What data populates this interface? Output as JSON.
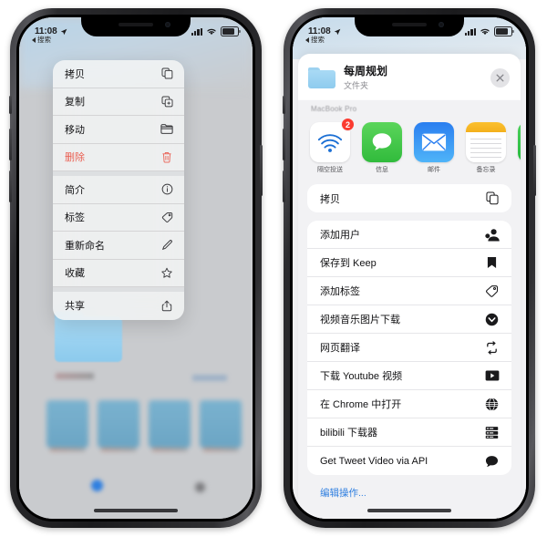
{
  "left_phone": {
    "status_bar": {
      "time": "11:08",
      "location_icon": "location-arrow-icon",
      "signal_icon": "cellular-signal-icon",
      "wifi_icon": "wifi-icon",
      "battery_icon": "battery-icon"
    },
    "back_link": "搜索",
    "context_menu": {
      "groups": [
        {
          "items": [
            {
              "label": "拷贝",
              "icon": "copy-icon",
              "destructive": false
            },
            {
              "label": "复制",
              "icon": "duplicate-icon",
              "destructive": false
            },
            {
              "label": "移动",
              "icon": "folder-move-icon",
              "destructive": false
            },
            {
              "label": "删除",
              "icon": "trash-icon",
              "destructive": true
            }
          ]
        },
        {
          "items": [
            {
              "label": "简介",
              "icon": "info-circle-icon",
              "destructive": false
            },
            {
              "label": "标签",
              "icon": "tag-icon",
              "destructive": false
            },
            {
              "label": "重新命名",
              "icon": "pencil-icon",
              "destructive": false
            },
            {
              "label": "收藏",
              "icon": "star-icon",
              "destructive": false
            }
          ]
        },
        {
          "items": [
            {
              "label": "共享",
              "icon": "share-icon",
              "destructive": false
            }
          ]
        }
      ]
    },
    "background": {
      "folder_icon": "folder-icon",
      "blurred_content": true
    }
  },
  "right_phone": {
    "status_bar": {
      "time": "11:08",
      "location_icon": "location-arrow-icon",
      "signal_icon": "cellular-signal-icon",
      "wifi_icon": "wifi-icon",
      "battery_icon": "battery-icon"
    },
    "back_link": "搜索",
    "share_sheet": {
      "header": {
        "icon": "folder-icon",
        "title": "每周规划",
        "subtitle": "文件夹",
        "close_icon": "close-icon"
      },
      "section_label": "MacBook Pro",
      "apps": [
        {
          "name": "隔空投送",
          "icon": "airdrop-icon",
          "badge": "2"
        },
        {
          "name": "信息",
          "icon": "messages-icon",
          "badge": ""
        },
        {
          "name": "邮件",
          "icon": "mail-icon",
          "badge": ""
        },
        {
          "name": "备忘录",
          "icon": "notes-icon",
          "badge": ""
        },
        {
          "name": "",
          "icon": "wechat-icon",
          "badge": ""
        }
      ],
      "action_groups": [
        {
          "items": [
            {
              "label": "拷贝",
              "icon": "copy-icon"
            }
          ]
        },
        {
          "items": [
            {
              "label": "添加用户",
              "icon": "add-user-icon"
            },
            {
              "label": "保存到 Keep",
              "icon": "bookmark-icon"
            },
            {
              "label": "添加标签",
              "icon": "tag-icon"
            },
            {
              "label": "视频音乐图片下载",
              "icon": "download-circle-icon"
            },
            {
              "label": "网页翻译",
              "icon": "refresh-icon"
            },
            {
              "label": "下载 Youtube 视频",
              "icon": "video-play-icon"
            },
            {
              "label": "在 Chrome 中打开",
              "icon": "globe-icon"
            },
            {
              "label": "bilibili 下载器",
              "icon": "server-list-icon"
            },
            {
              "label": "Get Tweet Video via API",
              "icon": "speech-bubble-icon"
            }
          ]
        }
      ],
      "edit_actions_label": "编辑操作..."
    }
  },
  "colors": {
    "destructive": "#ea5f52",
    "accent_blue": "#2f7fe0",
    "badge_red": "#fb3b30",
    "folder_blue": "#9ed2f0"
  }
}
